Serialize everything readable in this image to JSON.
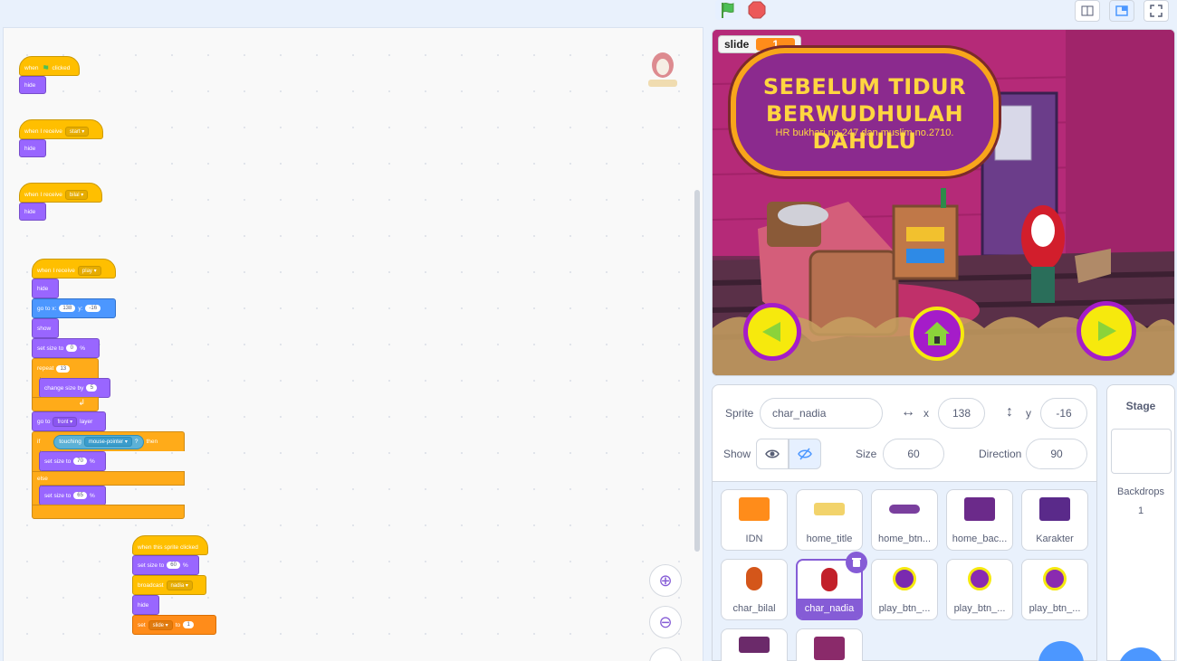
{
  "topbar": {
    "flag_icon": "green-flag-icon",
    "stop_icon": "stop-icon",
    "layout_buttons": [
      "small-stage-icon",
      "normal-stage-icon",
      "fullscreen-icon"
    ]
  },
  "scripts": {
    "s1": {
      "hat": "when",
      "hat_end": "clicked",
      "hide": "hide"
    },
    "s2": {
      "hat": "when I receive",
      "msg": "start",
      "hide": "hide"
    },
    "s3": {
      "hat": "when I receive",
      "msg": "bilal",
      "hide": "hide"
    },
    "s4": {
      "hat": "when I receive",
      "msg": "play",
      "hide": "hide",
      "goto": "go to x:",
      "x": "138",
      "y_lbl": "y:",
      "y": "-16",
      "show": "show",
      "setsize": "set size to",
      "size0": "0",
      "pct": "%",
      "repeat": "repeat",
      "repeat_n": "13",
      "change": "change size by",
      "change_n": "5",
      "goto_layer": "go to",
      "front": "front",
      "layer": "layer",
      "if": "if",
      "touching": "touching",
      "mouse": "mouse-pointer",
      "q": "?",
      "then": "then",
      "size70": "70",
      "else": "else",
      "size65": "65"
    },
    "s5": {
      "hat": "when this sprite clicked",
      "setsize": "set size to",
      "size": "60",
      "pct": "%",
      "broadcast": "broadcast",
      "msg": "nadia",
      "hide": "hide",
      "set": "set",
      "var": "slide",
      "to": "to",
      "val": "1"
    }
  },
  "zoom": {
    "in": "⊕",
    "out": "⊖"
  },
  "stage": {
    "monitor_label": "slide",
    "monitor_value": "1",
    "title_line1": "SEBELUM TIDUR",
    "title_line2": "BERWUDHULAH DAHULU",
    "subtitle": "HR bukhari no.247 dan muslim no.2710."
  },
  "sprite_info": {
    "sprite_label": "Sprite",
    "sprite_name": "char_nadia",
    "x_label": "x",
    "x_value": "138",
    "y_label": "y",
    "y_value": "-16",
    "show_label": "Show",
    "size_label": "Size",
    "size_value": "60",
    "direction_label": "Direction",
    "direction_value": "90"
  },
  "sprites": [
    {
      "name": "IDN",
      "color": "#ff8c1a"
    },
    {
      "name": "home_title",
      "color": "#f2d36b"
    },
    {
      "name": "home_btn...",
      "color": "#7a3f9e"
    },
    {
      "name": "home_bac...",
      "color": "#6b2a8a"
    },
    {
      "name": "Karakter",
      "color": "#5a2a8a"
    },
    {
      "name": "char_bilal",
      "color": "#d4561a"
    },
    {
      "name": "char_nadia",
      "color": "#c2202a"
    },
    {
      "name": "play_btn_...",
      "color": "#7a2ab0"
    },
    {
      "name": "play_btn_...",
      "color": "#8a2ab0"
    },
    {
      "name": "play_btn_...",
      "color": "#8a2ab0"
    }
  ],
  "stage_pane": {
    "title": "Stage",
    "backdrops_label": "Backdrops",
    "backdrops_count": "1"
  }
}
